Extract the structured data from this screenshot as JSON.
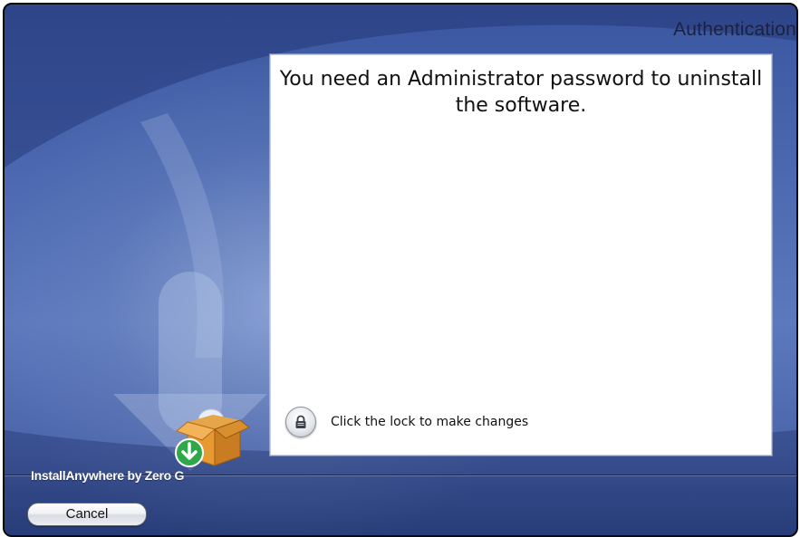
{
  "window": {
    "title": "Authentication"
  },
  "content": {
    "message": "You need an Administrator password to uninstall the software.",
    "lock_label": "Click the lock to make changes"
  },
  "footer": {
    "brand": "InstallAnywhere by Zero G",
    "cancel_label": "Cancel"
  },
  "icons": {
    "lock": "lock-icon",
    "installer_box": "installer-box-icon",
    "download_arrow": "download-arrow-icon"
  },
  "colors": {
    "background_top": "#3a56a0",
    "background_mid": "#5d79bd",
    "title_text": "#1b2240",
    "download_badge": "#2fa84a"
  }
}
